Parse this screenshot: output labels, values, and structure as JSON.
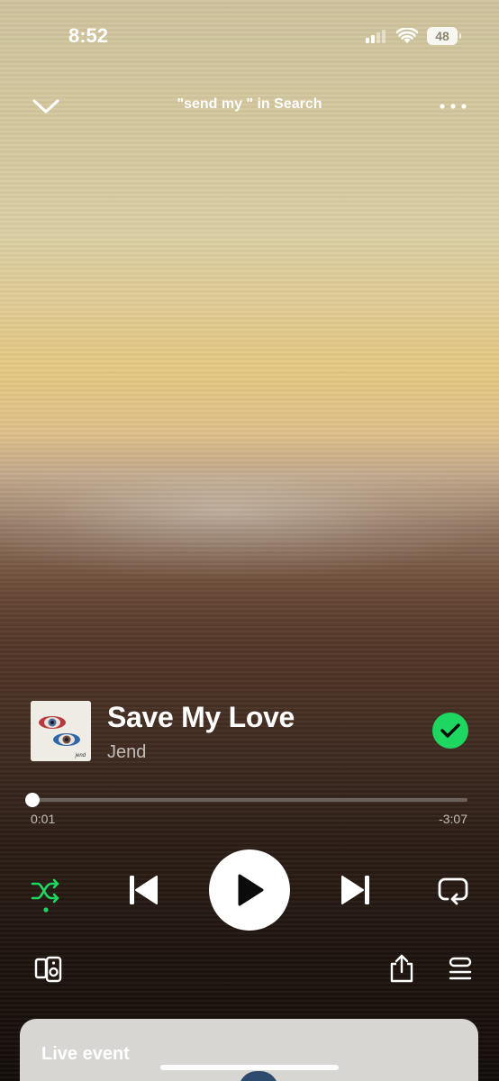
{
  "status_bar": {
    "time": "8:52",
    "battery": "48",
    "signal_icon": "cellular-signal-icon",
    "wifi_icon": "wifi-icon"
  },
  "header": {
    "context": "\"send my \" in Search",
    "collapse_icon": "chevron-down-icon",
    "more_icon": "more-dots-icon"
  },
  "track": {
    "title": "Save My Love",
    "artist": "Jend",
    "liked": true,
    "cover_caption": "jend"
  },
  "progress": {
    "elapsed": "0:01",
    "remaining": "-3:07",
    "fraction": 0.005
  },
  "controls": {
    "shuffle_icon": "shuffle-icon",
    "shuffle_active": true,
    "previous_icon": "skip-previous-icon",
    "play_icon": "play-icon",
    "next_icon": "skip-next-icon",
    "repeat_icon": "repeat-icon",
    "devices_icon": "connect-devices-icon",
    "share_icon": "share-icon",
    "queue_icon": "queue-icon"
  },
  "bottom_sheet": {
    "label": "Live event"
  },
  "colors": {
    "accent_green": "#1ed760",
    "text_white": "#ffffff"
  }
}
